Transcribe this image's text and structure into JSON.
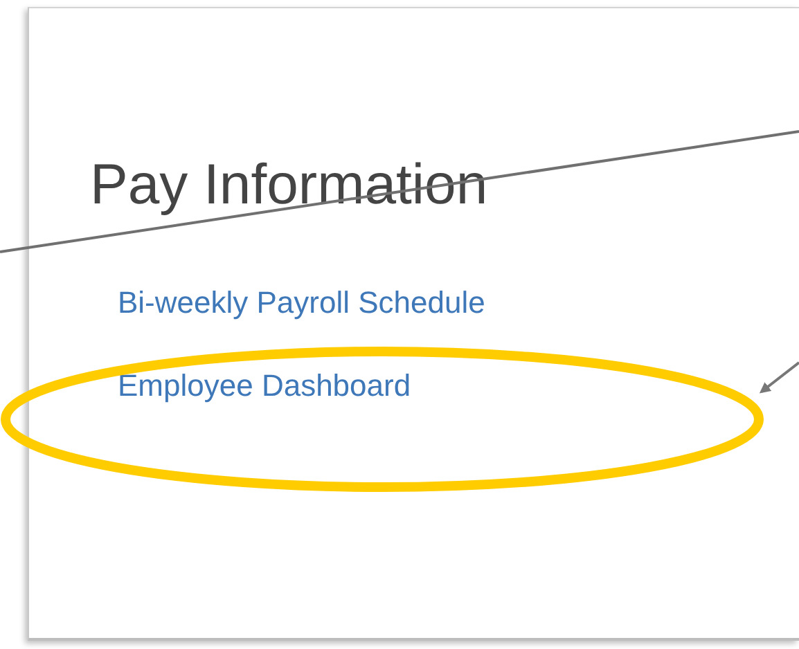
{
  "page": {
    "title": "Pay Information",
    "links": [
      {
        "label": "Bi-weekly Payroll Schedule"
      },
      {
        "label": "Employee Dashboard"
      }
    ]
  }
}
